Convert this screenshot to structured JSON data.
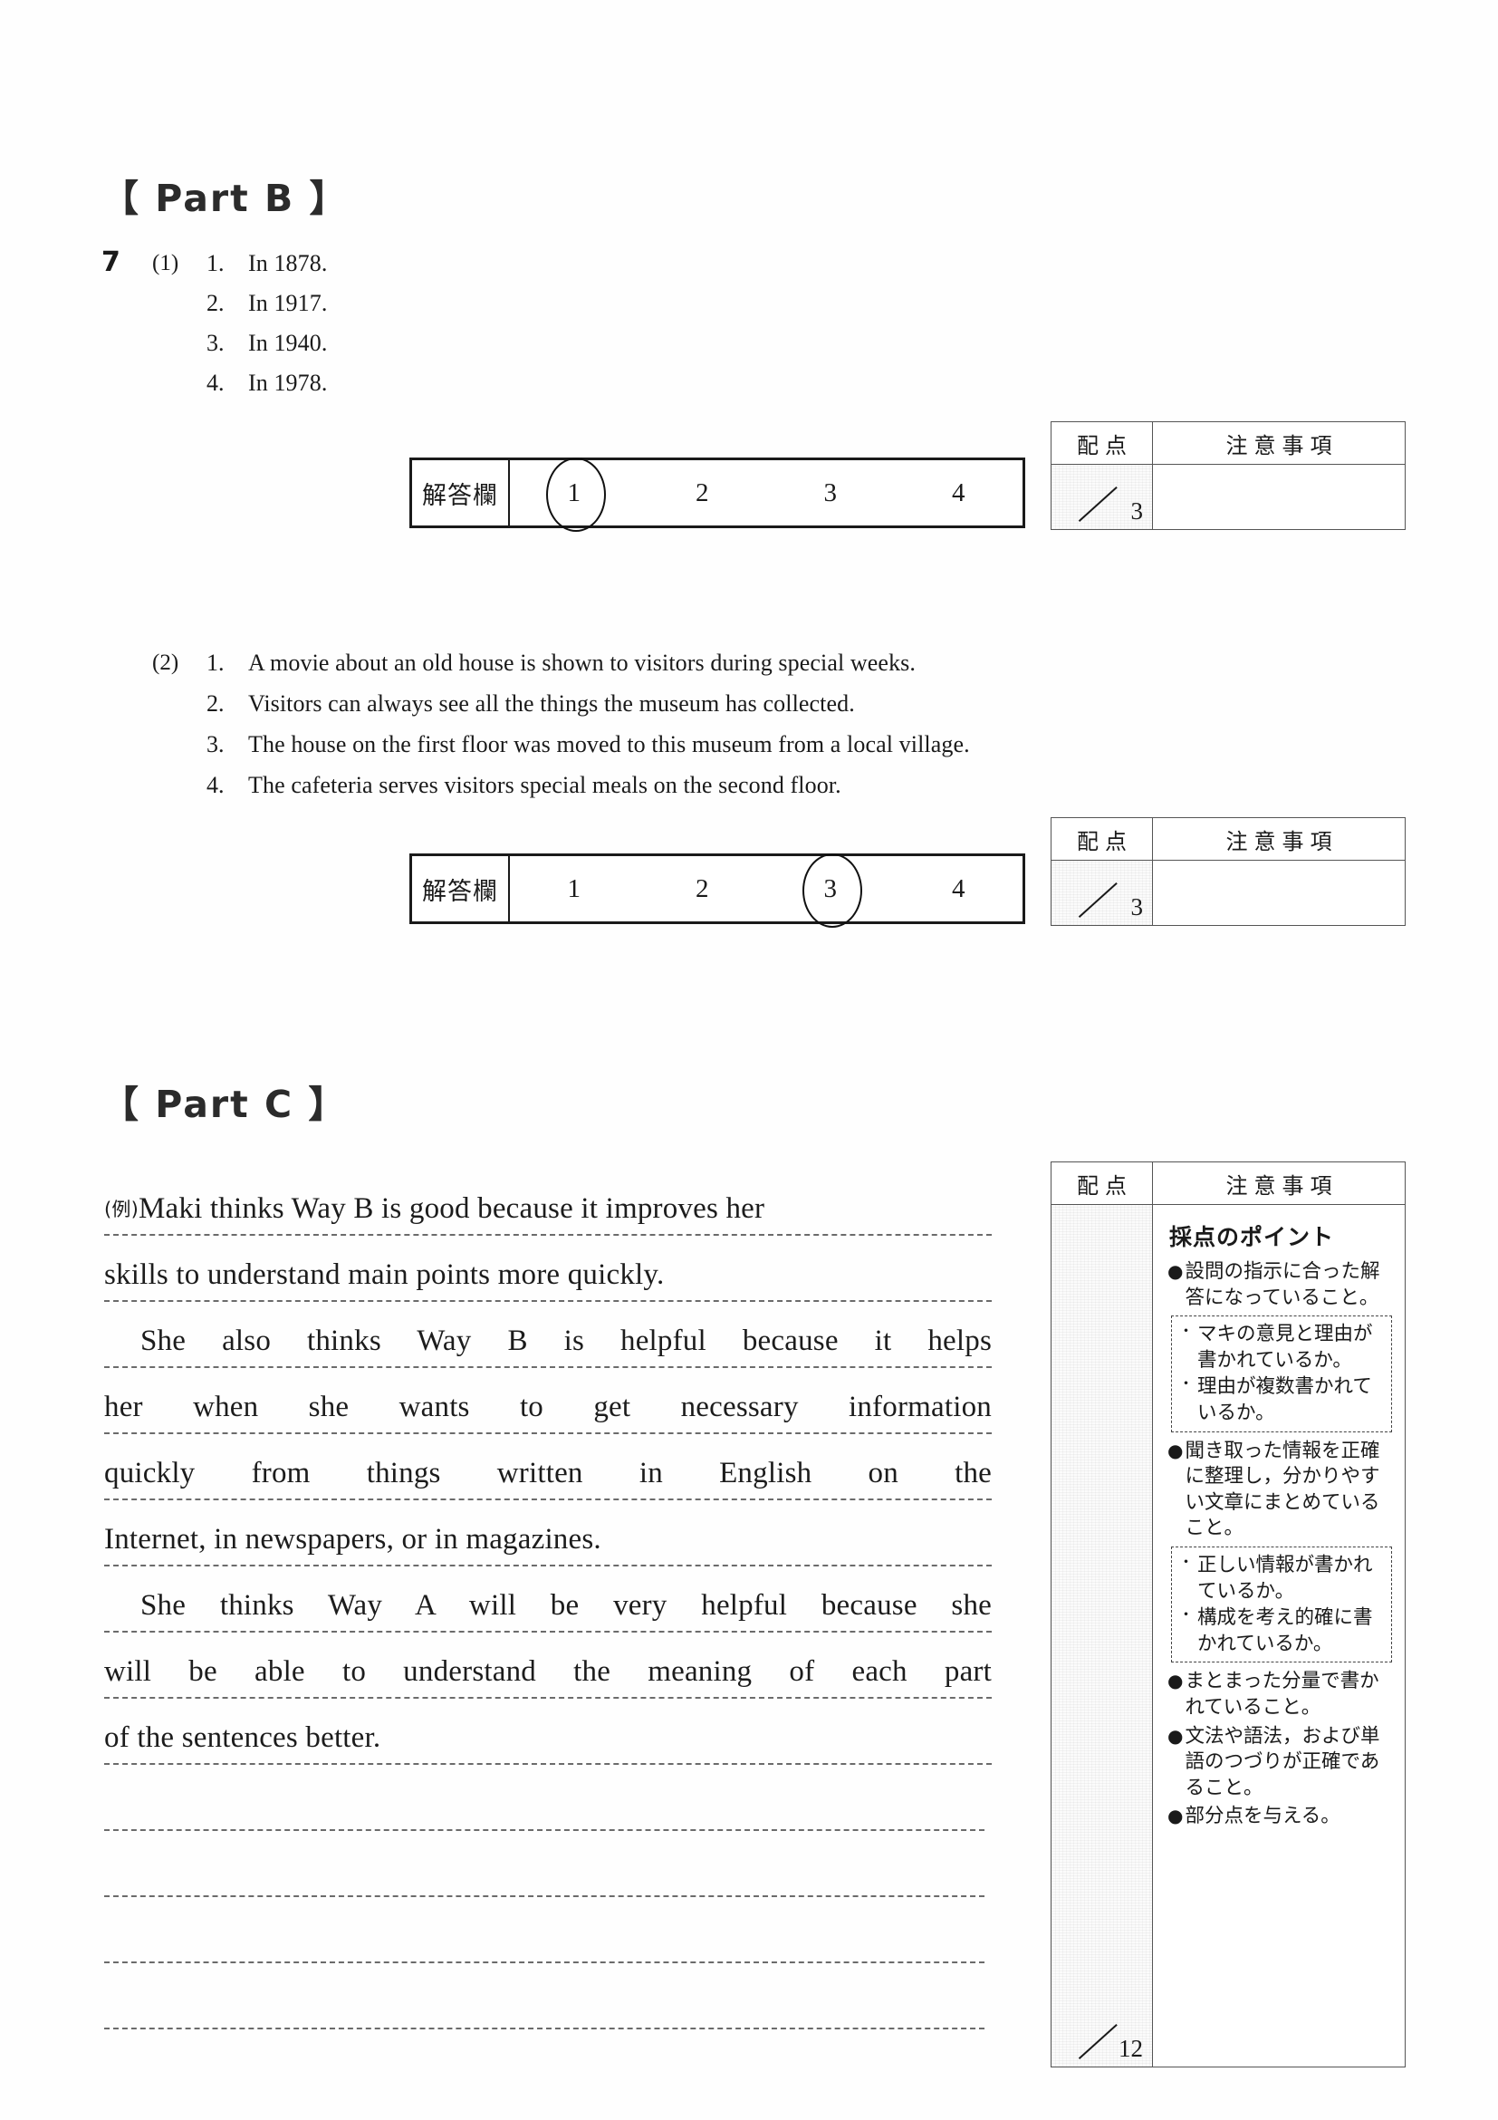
{
  "part_b": {
    "heading": "【 Part B 】",
    "question_number": "7",
    "items": [
      {
        "sub_label": "(1)",
        "options": [
          {
            "num": "1.",
            "text": "In 1878."
          },
          {
            "num": "2.",
            "text": "In 1917."
          },
          {
            "num": "3.",
            "text": "In 1940."
          },
          {
            "num": "4.",
            "text": "In 1978."
          }
        ],
        "answer_row": {
          "label": "解答欄",
          "choices": [
            "1",
            "2",
            "3",
            "4"
          ],
          "selected_index": 0
        },
        "score": {
          "haiten_header": "配点",
          "chui_header": "注意事項",
          "max_points": "3",
          "notes": ""
        }
      },
      {
        "sub_label": "(2)",
        "options": [
          {
            "num": "1.",
            "text": "A movie about an old house is shown to visitors during special weeks."
          },
          {
            "num": "2.",
            "text": "Visitors can always see all the things the museum has collected."
          },
          {
            "num": "3.",
            "text": "The house on the first floor was moved to this museum from a local village."
          },
          {
            "num": "4.",
            "text": "The cafeteria serves visitors special meals on the second floor."
          }
        ],
        "answer_row": {
          "label": "解答欄",
          "choices": [
            "1",
            "2",
            "3",
            "4"
          ],
          "selected_index": 2
        },
        "score": {
          "haiten_header": "配点",
          "chui_header": "注意事項",
          "max_points": "3",
          "notes": ""
        }
      }
    ]
  },
  "part_c": {
    "heading": "【 Part C 】",
    "example_marker": "(例)",
    "essay_lines": [
      "Maki thinks Way B is good because it improves her",
      "skills to understand main points more quickly.",
      "She also thinks Way B is helpful because it helps",
      "her when she wants to get necessary information",
      "quickly from things written in English on the",
      "Internet, in newspapers, or in magazines.",
      "She thinks Way A will be very helpful because she",
      "will be able to understand the meaning of each part",
      "of the sentences better."
    ],
    "score": {
      "haiten_header": "配点",
      "chui_header": "注意事項",
      "max_points": "12",
      "notes_title": "採点のポイント",
      "notes": [
        {
          "marker": "●",
          "text": "設問の指示に合った解答になっていること。"
        },
        {
          "dashed": true,
          "items": [
            {
              "marker": "・",
              "text": "マキの意見と理由が書かれているか。"
            },
            {
              "marker": "・",
              "text": "理由が複数書かれているか。"
            }
          ]
        },
        {
          "marker": "●",
          "text": "聞き取った情報を正確に整理し，分かりやすい文章にまとめていること。"
        },
        {
          "dashed": true,
          "items": [
            {
              "marker": "・",
              "text": "正しい情報が書かれているか。"
            },
            {
              "marker": "・",
              "text": "構成を考え的確に書かれているか。"
            }
          ]
        },
        {
          "marker": "●",
          "text": "まとまった分量で書かれていること。"
        },
        {
          "marker": "●",
          "text": "文法や語法，および単語のつづりが正確であること。"
        },
        {
          "marker": "●",
          "text": "部分点を与える。"
        }
      ]
    }
  }
}
